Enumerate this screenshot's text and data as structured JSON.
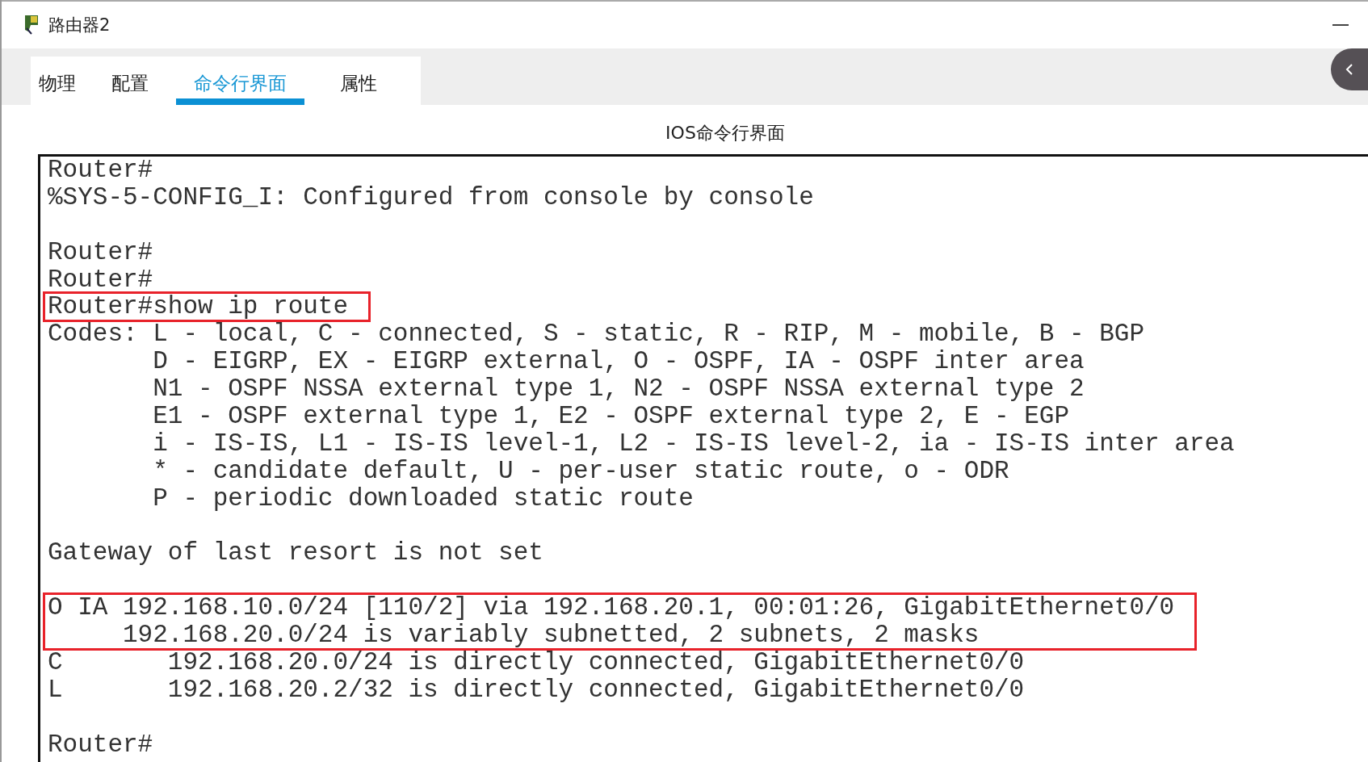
{
  "window": {
    "title": "路由器2"
  },
  "tabs": [
    {
      "label": "物理",
      "selected": false
    },
    {
      "label": "配置",
      "selected": false
    },
    {
      "label": "命令行界面",
      "selected": true
    },
    {
      "label": "属性",
      "selected": false
    }
  ],
  "panel_title": "IOS命令行界面",
  "terminal": {
    "blocks": [
      {
        "kind": "text",
        "lines": [
          "Router#",
          "%SYS-5-CONFIG_I: Configured from console by console"
        ]
      },
      {
        "kind": "gap"
      },
      {
        "kind": "text",
        "lines": [
          "Router#",
          "Router#"
        ]
      },
      {
        "kind": "highlight",
        "lines": [
          "Router#show ip route"
        ]
      },
      {
        "kind": "text",
        "lines": [
          "Codes: L - local, C - connected, S - static, R - RIP, M - mobile, B - BGP",
          "       D - EIGRP, EX - EIGRP external, O - OSPF, IA - OSPF inter area",
          "       N1 - OSPF NSSA external type 1, N2 - OSPF NSSA external type 2",
          "       E1 - OSPF external type 1, E2 - OSPF external type 2, E - EGP",
          "       i - IS-IS, L1 - IS-IS level-1, L2 - IS-IS level-2, ia - IS-IS inter area",
          "       * - candidate default, U - per-user static route, o - ODR",
          "       P - periodic downloaded static route"
        ]
      },
      {
        "kind": "gap"
      },
      {
        "kind": "text",
        "lines": [
          "Gateway of last resort is not set"
        ]
      },
      {
        "kind": "gap"
      },
      {
        "kind": "highlight",
        "lines": [
          "O IA 192.168.10.0/24 [110/2] via 192.168.20.1, 00:01:26, GigabitEthernet0/0",
          "     192.168.20.0/24 is variably subnetted, 2 subnets, 2 masks"
        ]
      },
      {
        "kind": "text",
        "lines": [
          "C       192.168.20.0/24 is directly connected, GigabitEthernet0/0",
          "L       192.168.20.2/32 is directly connected, GigabitEthernet0/0"
        ]
      },
      {
        "kind": "gap"
      },
      {
        "kind": "text",
        "lines": [
          "Router#"
        ]
      }
    ]
  }
}
